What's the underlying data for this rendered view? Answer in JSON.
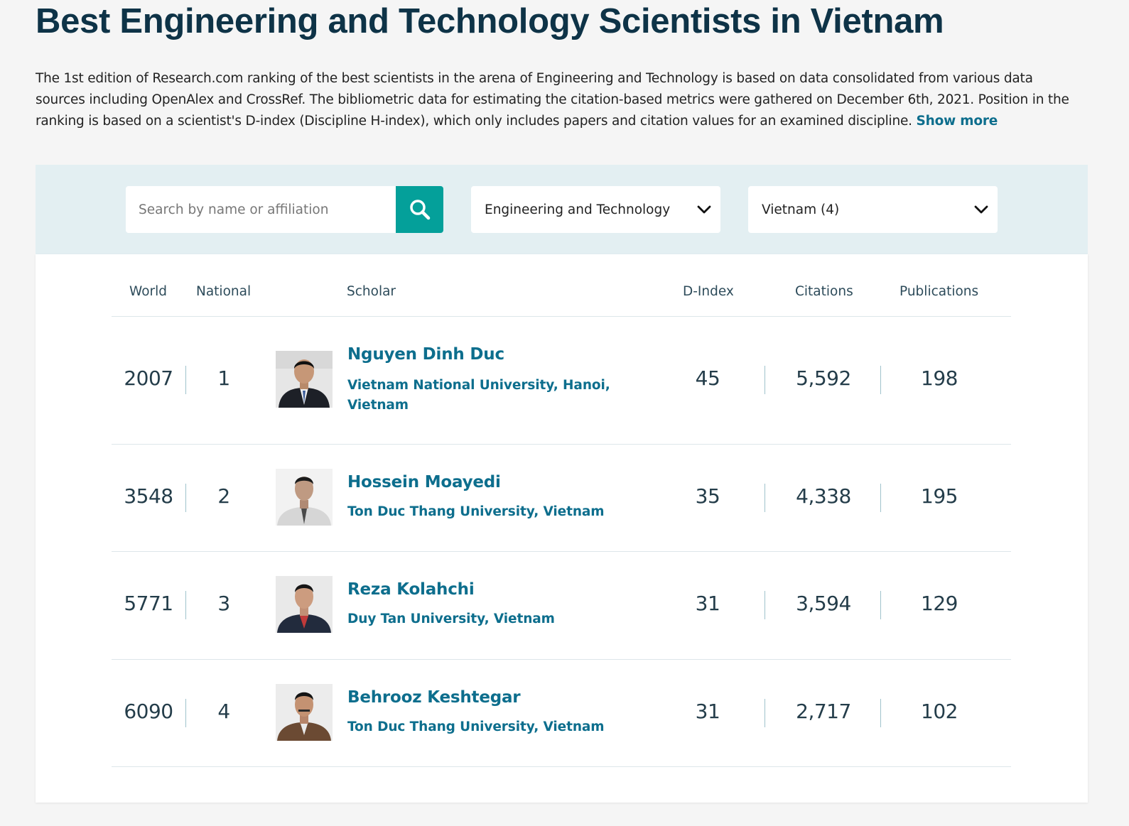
{
  "page": {
    "title": "Best Engineering and Technology Scientists in Vietnam",
    "intro": "The 1st edition of Research.com ranking of the best scientists in the arena of Engineering and Technology is based on data consolidated from various data sources including OpenAlex and CrossRef. The bibliometric data for estimating the citation-based metrics were gathered on December 6th, 2021. Position in the ranking is based on a scientist's D-index (Discipline H-index), which only includes papers and citation values for an examined discipline.",
    "show_more": "Show more"
  },
  "filters": {
    "search_placeholder": "Search by name or affiliation",
    "search_icon": "search-icon",
    "discipline": "Engineering and Technology",
    "country": "Vietnam (4)"
  },
  "colors": {
    "accent": "#04a09a",
    "link": "#0d6e8d",
    "title": "#0e3347",
    "filter_bg": "#e3eff2"
  },
  "table": {
    "headers": {
      "world": "World",
      "national": "National",
      "scholar": "Scholar",
      "dindex": "D-Index",
      "citations": "Citations",
      "publications": "Publications"
    },
    "rows": [
      {
        "world": "2007",
        "national": "1",
        "name": "Nguyen Dinh Duc",
        "affiliation": "Vietnam National University, Hanoi, Vietnam",
        "dindex": "45",
        "citations": "5,592",
        "publications": "198"
      },
      {
        "world": "3548",
        "national": "2",
        "name": "Hossein Moayedi",
        "affiliation": "Ton Duc Thang University, Vietnam",
        "dindex": "35",
        "citations": "4,338",
        "publications": "195"
      },
      {
        "world": "5771",
        "national": "3",
        "name": "Reza Kolahchi",
        "affiliation": "Duy Tan University, Vietnam",
        "dindex": "31",
        "citations": "3,594",
        "publications": "129"
      },
      {
        "world": "6090",
        "national": "4",
        "name": "Behrooz Keshtegar",
        "affiliation": "Ton Duc Thang University, Vietnam",
        "dindex": "31",
        "citations": "2,717",
        "publications": "102"
      }
    ]
  }
}
